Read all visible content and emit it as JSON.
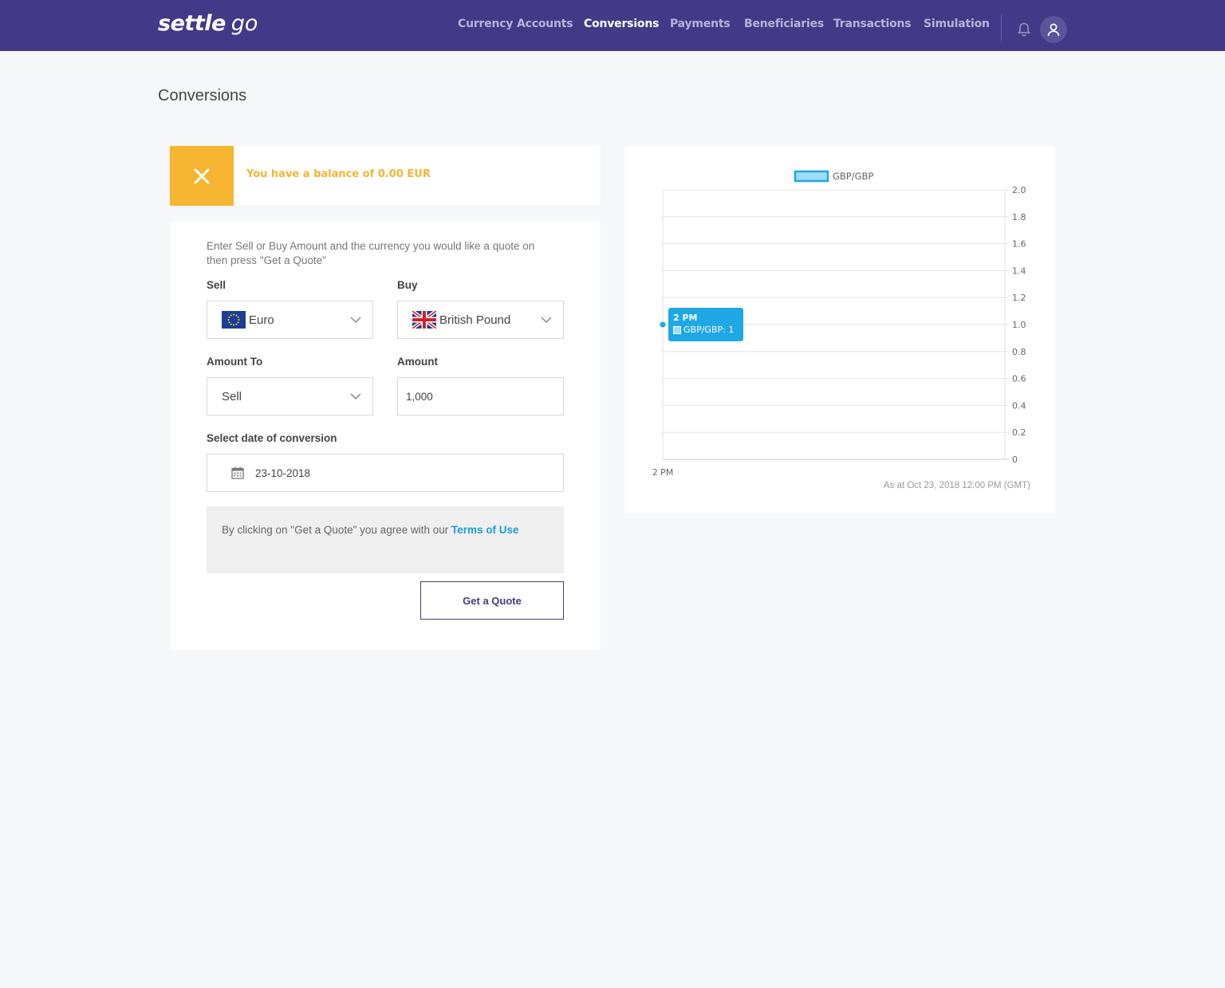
{
  "app": {
    "logo_bold": "settle",
    "logo_light": "go"
  },
  "nav": [
    {
      "label": "Currency Accounts",
      "active": false
    },
    {
      "label": "Conversions",
      "active": true
    },
    {
      "label": "Payments",
      "active": false
    },
    {
      "label": "Beneficiaries",
      "active": false
    },
    {
      "label": "Transactions",
      "active": false
    },
    {
      "label": "Simulation",
      "active": false
    }
  ],
  "page": {
    "title": "Conversions"
  },
  "balance": {
    "prefix": "You have a balance of ",
    "amount": "0.00 EUR",
    "accent": "#f5b531"
  },
  "form": {
    "intro": "Enter Sell or Buy Amount and the currency you would like a quote on then press \"Get a Quote\"",
    "sell_label": "Sell",
    "sell_value": "Euro",
    "buy_label": "Buy",
    "buy_value": "British Pound",
    "amount_to_label": "Amount To",
    "amount_to_value": "Sell",
    "amount_label": "Amount",
    "amount_value": "1,000",
    "date_label": "Select date of conversion",
    "date_value": "23-10-2018",
    "terms_text": "By clicking on \"Get a Quote\" you agree with our ",
    "terms_link": "Terms of Use",
    "quote_button": "Get a Quote"
  },
  "chart_data": {
    "type": "line",
    "title": "",
    "xlabel": "",
    "ylabel": "",
    "x": [
      "2 PM"
    ],
    "series": [
      {
        "name": "GBP/GBP",
        "values": [
          1
        ],
        "color": "#1fa7e6"
      }
    ],
    "ylim": [
      0,
      2.0
    ],
    "yticks": [
      "0",
      "0.2",
      "0.4",
      "0.6",
      "0.8",
      "1.0",
      "1.2",
      "1.4",
      "1.6",
      "1.8",
      "2.0"
    ],
    "grid": true,
    "legend": "top",
    "y_axis_side": "right",
    "tooltip": {
      "title": "2 PM",
      "label": "GBP/GBP: 1"
    },
    "footnote": "As at Oct 23, 2018 12:00 PM (GMT)"
  },
  "colors": {
    "header": "#433a87",
    "link": "#1a9fd8"
  }
}
